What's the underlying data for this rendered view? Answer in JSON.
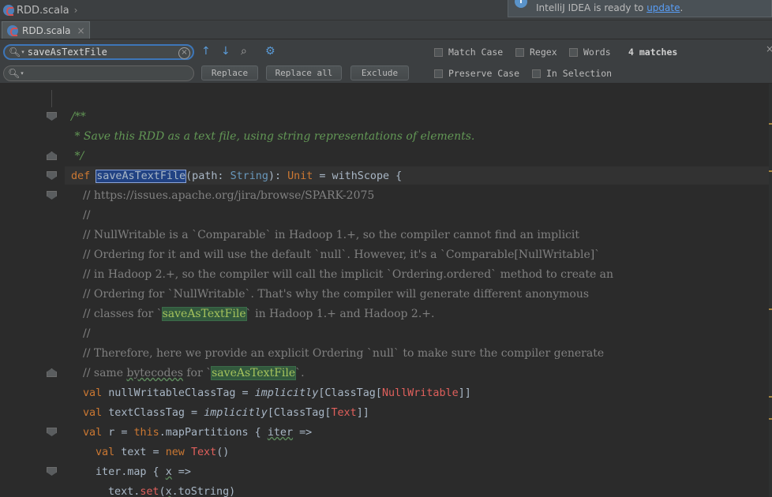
{
  "navbar": {
    "breadcrumb": "RDD.scala"
  },
  "notification": {
    "prefix": "IntelliJ IDEA is ready to ",
    "link": "update",
    "suffix": "."
  },
  "tabs": [
    {
      "label": "RDD.scala",
      "close": "×"
    }
  ],
  "find": {
    "query": "saveAsTextFile",
    "replace_value": "",
    "buttons": {
      "replace": "Replace",
      "replace_all": "Replace all",
      "exclude": "Exclude"
    },
    "options": {
      "match_case": "Match Case",
      "regex": "Regex",
      "words": "Words",
      "preserve_case": "Preserve Case",
      "in_selection": "In Selection"
    },
    "match_count": "4 matches"
  },
  "code": {
    "l1": "/**",
    "l2": " * Save this RDD as a text file, using string representations of elements.",
    "l3": " */",
    "l4": [
      "def ",
      "saveAsTextFile",
      "(path: ",
      "String",
      "): ",
      "Unit",
      " = withScope {"
    ],
    "l5": "// https://issues.apache.org/jira/browse/SPARK-2075",
    "l6": "//",
    "l7": "// NullWritable is a `Comparable` in Hadoop 1.+, so the compiler cannot find an implicit",
    "l8": "// Ordering for it and will use the default `null`. However, it's a `Comparable[NullWritable]`",
    "l9": "// in Hadoop 2.+, so the compiler will call the implicit `Ordering.ordered` method to create an",
    "l10": "// Ordering for `NullWritable`. That's why the compiler will generate different anonymous",
    "l11": [
      "// classes for `",
      "saveAsTextFile",
      "` in Hadoop 1.+ and Hadoop 2.+."
    ],
    "l12": "//",
    "l13": "// Therefore, here we provide an explicit Ordering `null` to make sure the compiler generate",
    "l14": [
      "// same ",
      "bytecodes",
      " for `",
      "saveAsTextFile",
      "`."
    ],
    "l15": [
      "val ",
      "nullWritableClassTag = ",
      "implicitly",
      "[ClassTag[",
      "NullWritable",
      "]]"
    ],
    "l16": [
      "val ",
      "textClassTag = ",
      "implicitly",
      "[ClassTag[",
      "Text",
      "]]"
    ],
    "l17": [
      "val ",
      "r = ",
      "this",
      ".mapPartitions { ",
      "iter",
      " =>"
    ],
    "l18": [
      "val ",
      "text = ",
      "new ",
      "Text",
      "()"
    ],
    "l19": [
      "iter",
      ".map { ",
      "x",
      " =>"
    ],
    "l20": [
      "text.",
      "set",
      "(",
      "x",
      ".toString)"
    ]
  }
}
